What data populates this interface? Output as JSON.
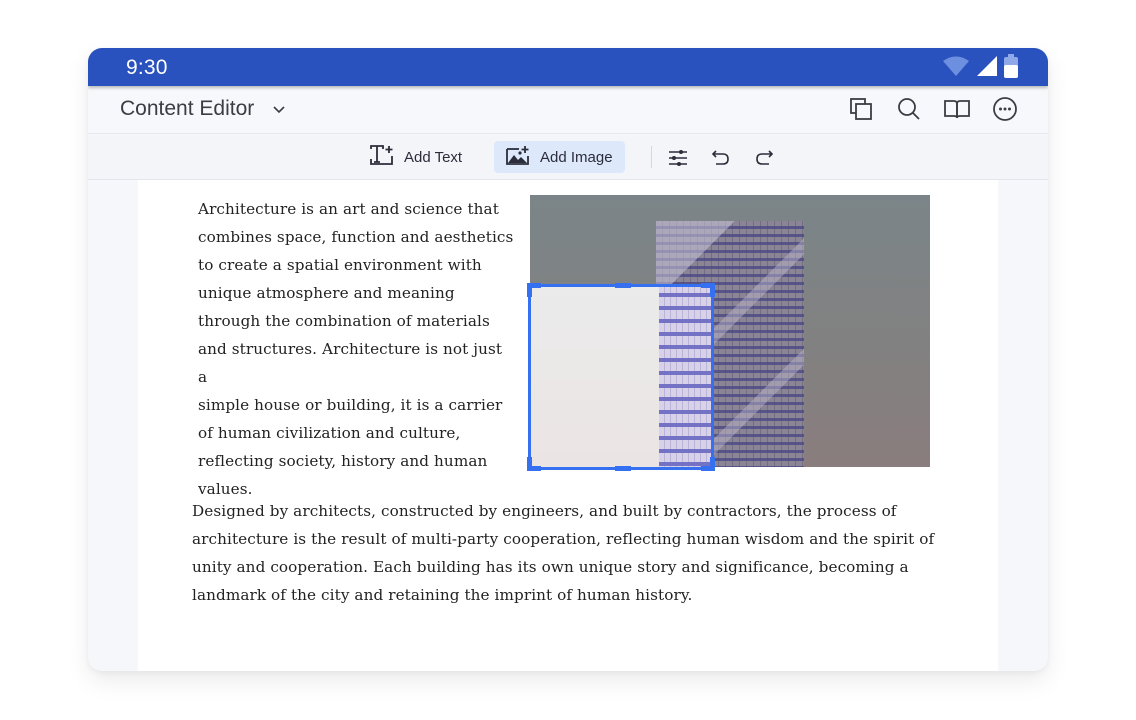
{
  "status_bar": {
    "time": "9:30",
    "icons": [
      "wifi-icon",
      "signal-icon",
      "battery-icon"
    ],
    "color": "#2a52be"
  },
  "app_bar": {
    "title": "Content Editor",
    "title_dropdown_icon": "chevron-down-icon",
    "actions": [
      {
        "name": "pages-icon"
      },
      {
        "name": "search-icon"
      },
      {
        "name": "read-mode-icon"
      },
      {
        "name": "more-icon"
      }
    ]
  },
  "toolbar": {
    "add_text_label": "Add Text",
    "add_image_label": "Add Image",
    "active_tool": "Add Image",
    "icons": [
      "adjust-icon",
      "undo-icon",
      "redo-icon"
    ],
    "accent": "#3570f0"
  },
  "document": {
    "paragraph1_lines": [
      "Architecture is an art and science that",
      "combines space, function and aesthetics",
      "to create a spatial environment with",
      "unique atmosphere and meaning",
      "through the combination of materials",
      "and structures. Architecture is not just a",
      "simple house or building, it is a carrier",
      "of human civilization and culture,",
      "reflecting society, history and human",
      "values."
    ],
    "paragraph2_lines": [
      "Designed by architects, constructed by engineers, and built by contractors, the process of",
      "architecture is the result of multi-party cooperation, reflecting human wisdom and the spirit of",
      "unity and cooperation. Each building has its own unique story and significance, becoming a",
      "landmark of the city and retaining the imprint of human history."
    ],
    "image": {
      "description": "skyscraper-photo",
      "crop_active": true
    }
  }
}
